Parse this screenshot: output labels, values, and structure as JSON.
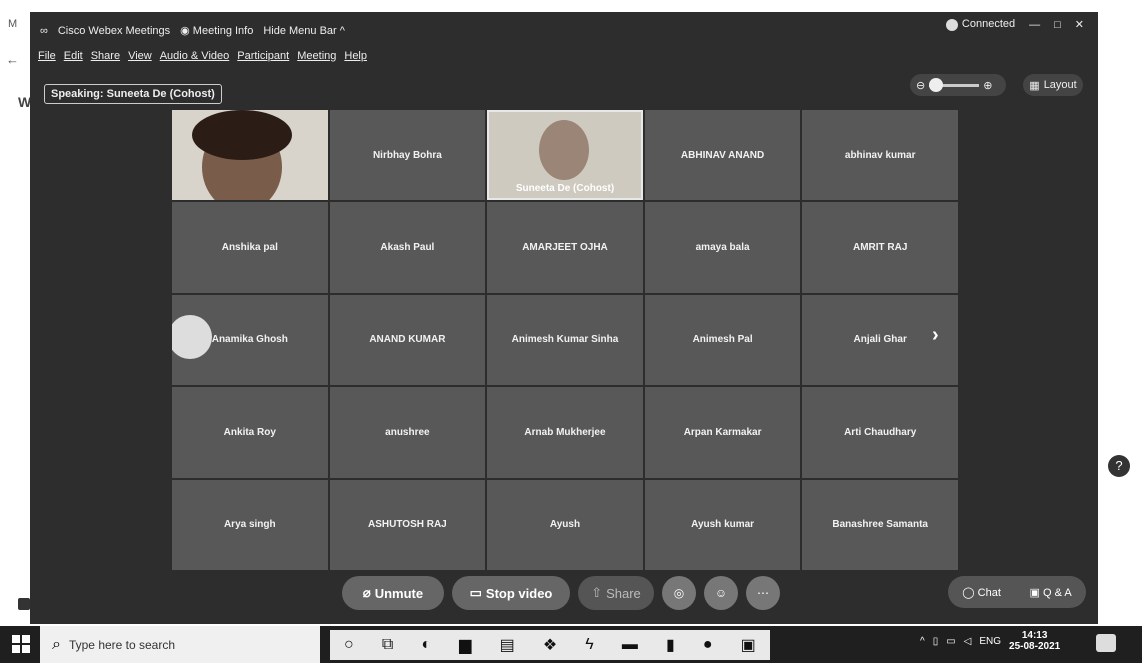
{
  "edge": {
    "m": "M",
    "back": "←",
    "w": "W",
    "help": "?"
  },
  "window": {
    "title": "Cisco Webex Meetings",
    "meeting_info": "Meeting Info",
    "hide_menu_bar": "Hide Menu Bar",
    "status": "Connected",
    "menu": [
      "File",
      "Edit",
      "Share",
      "View",
      "Audio & Video",
      "Participant",
      "Meeting",
      "Help"
    ],
    "speaking": "Speaking: Suneeta De (Cohost)",
    "layout_label": "Layout"
  },
  "participants": [
    {
      "name": "",
      "video": true
    },
    {
      "name": "Nirbhay Bohra"
    },
    {
      "name": "Suneeta De (Cohost)",
      "video": true
    },
    {
      "name": "ABHINAV ANAND"
    },
    {
      "name": "abhinav kumar"
    },
    {
      "name": "Anshika pal"
    },
    {
      "name": "Akash Paul"
    },
    {
      "name": "AMARJEET OJHA"
    },
    {
      "name": "amaya bala"
    },
    {
      "name": "AMRIT RAJ"
    },
    {
      "name": "Anamika Ghosh"
    },
    {
      "name": "ANAND KUMAR"
    },
    {
      "name": "Animesh Kumar Sinha"
    },
    {
      "name": "Animesh Pal"
    },
    {
      "name": "Anjali Ghar"
    },
    {
      "name": "Ankita Roy"
    },
    {
      "name": "anushree"
    },
    {
      "name": "Arnab Mukherjee"
    },
    {
      "name": "Arpan Karmakar"
    },
    {
      "name": "Arti Chaudhary"
    },
    {
      "name": "Arya singh"
    },
    {
      "name": "ASHUTOSH RAJ"
    },
    {
      "name": "Ayush"
    },
    {
      "name": "Ayush kumar"
    },
    {
      "name": "Banashree Samanta"
    }
  ],
  "controls": {
    "unmute": "Unmute",
    "stop_video": "Stop video",
    "share": "Share",
    "chat": "Chat",
    "qa": "Q & A"
  },
  "taskbar": {
    "search_placeholder": "Type here to search",
    "lang": "ENG",
    "time": "14:13",
    "date": "25-08-2021"
  }
}
